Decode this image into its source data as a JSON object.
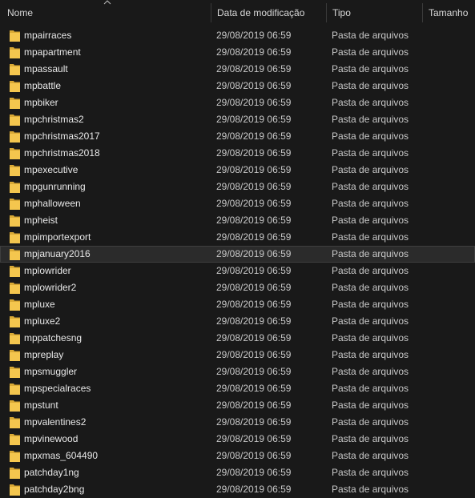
{
  "columns": {
    "name": "Nome",
    "date": "Data de modificação",
    "type": "Tipo",
    "size": "Tamanho"
  },
  "sort": {
    "column": "name",
    "direction": "ascending"
  },
  "colors": {
    "folder": "#f4c64e",
    "folder_dark": "#d9a935",
    "background": "#191919",
    "selected_row": "#2b2b2b"
  },
  "selected_index": 13,
  "files": [
    {
      "name": "mpairraces",
      "date": "29/08/2019 06:59",
      "type": "Pasta de arquivos",
      "icon": "folder-icon"
    },
    {
      "name": "mpapartment",
      "date": "29/08/2019 06:59",
      "type": "Pasta de arquivos",
      "icon": "folder-icon"
    },
    {
      "name": "mpassault",
      "date": "29/08/2019 06:59",
      "type": "Pasta de arquivos",
      "icon": "folder-icon"
    },
    {
      "name": "mpbattle",
      "date": "29/08/2019 06:59",
      "type": "Pasta de arquivos",
      "icon": "folder-icon"
    },
    {
      "name": "mpbiker",
      "date": "29/08/2019 06:59",
      "type": "Pasta de arquivos",
      "icon": "folder-icon"
    },
    {
      "name": "mpchristmas2",
      "date": "29/08/2019 06:59",
      "type": "Pasta de arquivos",
      "icon": "folder-icon"
    },
    {
      "name": "mpchristmas2017",
      "date": "29/08/2019 06:59",
      "type": "Pasta de arquivos",
      "icon": "folder-icon"
    },
    {
      "name": "mpchristmas2018",
      "date": "29/08/2019 06:59",
      "type": "Pasta de arquivos",
      "icon": "folder-icon"
    },
    {
      "name": "mpexecutive",
      "date": "29/08/2019 06:59",
      "type": "Pasta de arquivos",
      "icon": "folder-icon"
    },
    {
      "name": "mpgunrunning",
      "date": "29/08/2019 06:59",
      "type": "Pasta de arquivos",
      "icon": "folder-icon"
    },
    {
      "name": "mphalloween",
      "date": "29/08/2019 06:59",
      "type": "Pasta de arquivos",
      "icon": "folder-icon"
    },
    {
      "name": "mpheist",
      "date": "29/08/2019 06:59",
      "type": "Pasta de arquivos",
      "icon": "folder-icon"
    },
    {
      "name": "mpimportexport",
      "date": "29/08/2019 06:59",
      "type": "Pasta de arquivos",
      "icon": "folder-icon"
    },
    {
      "name": "mpjanuary2016",
      "date": "29/08/2019 06:59",
      "type": "Pasta de arquivos",
      "icon": "folder-icon"
    },
    {
      "name": "mplowrider",
      "date": "29/08/2019 06:59",
      "type": "Pasta de arquivos",
      "icon": "folder-icon"
    },
    {
      "name": "mplowrider2",
      "date": "29/08/2019 06:59",
      "type": "Pasta de arquivos",
      "icon": "folder-icon"
    },
    {
      "name": "mpluxe",
      "date": "29/08/2019 06:59",
      "type": "Pasta de arquivos",
      "icon": "folder-icon"
    },
    {
      "name": "mpluxe2",
      "date": "29/08/2019 06:59",
      "type": "Pasta de arquivos",
      "icon": "folder-icon"
    },
    {
      "name": "mppatchesng",
      "date": "29/08/2019 06:59",
      "type": "Pasta de arquivos",
      "icon": "folder-icon"
    },
    {
      "name": "mpreplay",
      "date": "29/08/2019 06:59",
      "type": "Pasta de arquivos",
      "icon": "folder-icon"
    },
    {
      "name": "mpsmuggler",
      "date": "29/08/2019 06:59",
      "type": "Pasta de arquivos",
      "icon": "folder-icon"
    },
    {
      "name": "mpspecialraces",
      "date": "29/08/2019 06:59",
      "type": "Pasta de arquivos",
      "icon": "folder-icon"
    },
    {
      "name": "mpstunt",
      "date": "29/08/2019 06:59",
      "type": "Pasta de arquivos",
      "icon": "folder-icon"
    },
    {
      "name": "mpvalentines2",
      "date": "29/08/2019 06:59",
      "type": "Pasta de arquivos",
      "icon": "folder-icon"
    },
    {
      "name": "mpvinewood",
      "date": "29/08/2019 06:59",
      "type": "Pasta de arquivos",
      "icon": "folder-icon"
    },
    {
      "name": "mpxmas_604490",
      "date": "29/08/2019 06:59",
      "type": "Pasta de arquivos",
      "icon": "folder-icon"
    },
    {
      "name": "patchday1ng",
      "date": "29/08/2019 06:59",
      "type": "Pasta de arquivos",
      "icon": "folder-icon"
    },
    {
      "name": "patchday2bng",
      "date": "29/08/2019 06:59",
      "type": "Pasta de arquivos",
      "icon": "folder-icon"
    }
  ]
}
